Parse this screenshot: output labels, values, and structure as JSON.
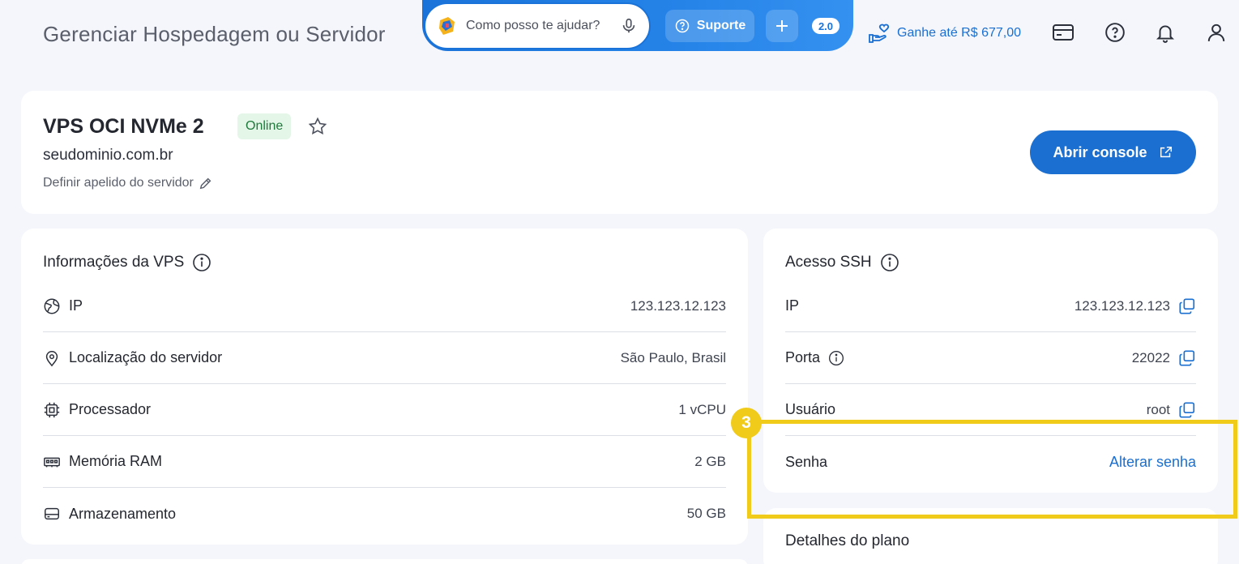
{
  "header": {
    "title": "Gerenciar Hospedagem ou Servidor",
    "assistant_placeholder": "Como posso te ajudar?",
    "support_label": "Suporte",
    "version": "2.0",
    "earn_label": "Ganhe até R$ 677,00",
    "icons": [
      "credit-card-icon",
      "help-icon",
      "bell-icon",
      "user-icon"
    ]
  },
  "server": {
    "name": "VPS OCI NVMe 2",
    "status": "Online",
    "domain": "seudominio.com.br",
    "nickname_label": "Definir apelido do servidor",
    "console_label": "Abrir console"
  },
  "vps_info": {
    "title": "Informações da VPS",
    "rows": [
      {
        "label": "IP",
        "value": "123.123.12.123",
        "icon": "globe-icon"
      },
      {
        "label": "Localização do servidor",
        "value": "São Paulo, Brasil",
        "icon": "location-icon"
      },
      {
        "label": "Processador",
        "value": "1 vCPU",
        "icon": "cpu-icon"
      },
      {
        "label": "Memória RAM",
        "value": "2 GB",
        "icon": "ram-icon"
      },
      {
        "label": "Armazenamento",
        "value": "50 GB",
        "icon": "storage-icon"
      }
    ]
  },
  "ssh": {
    "title": "Acesso SSH",
    "rows": [
      {
        "label": "IP",
        "value": "123.123.12.123"
      },
      {
        "label": "Porta",
        "value": "22022"
      },
      {
        "label": "Usuário",
        "value": "root"
      },
      {
        "label": "Senha",
        "value": "Alterar senha"
      }
    ]
  },
  "plan": {
    "title": "Detalhes do plano"
  },
  "annotation": {
    "step": "3"
  },
  "colors": {
    "accent": "#1a6fd1",
    "highlight": "#f0cb1a",
    "online_bg": "#e4f6e8",
    "online_text": "#1d7a3a"
  }
}
